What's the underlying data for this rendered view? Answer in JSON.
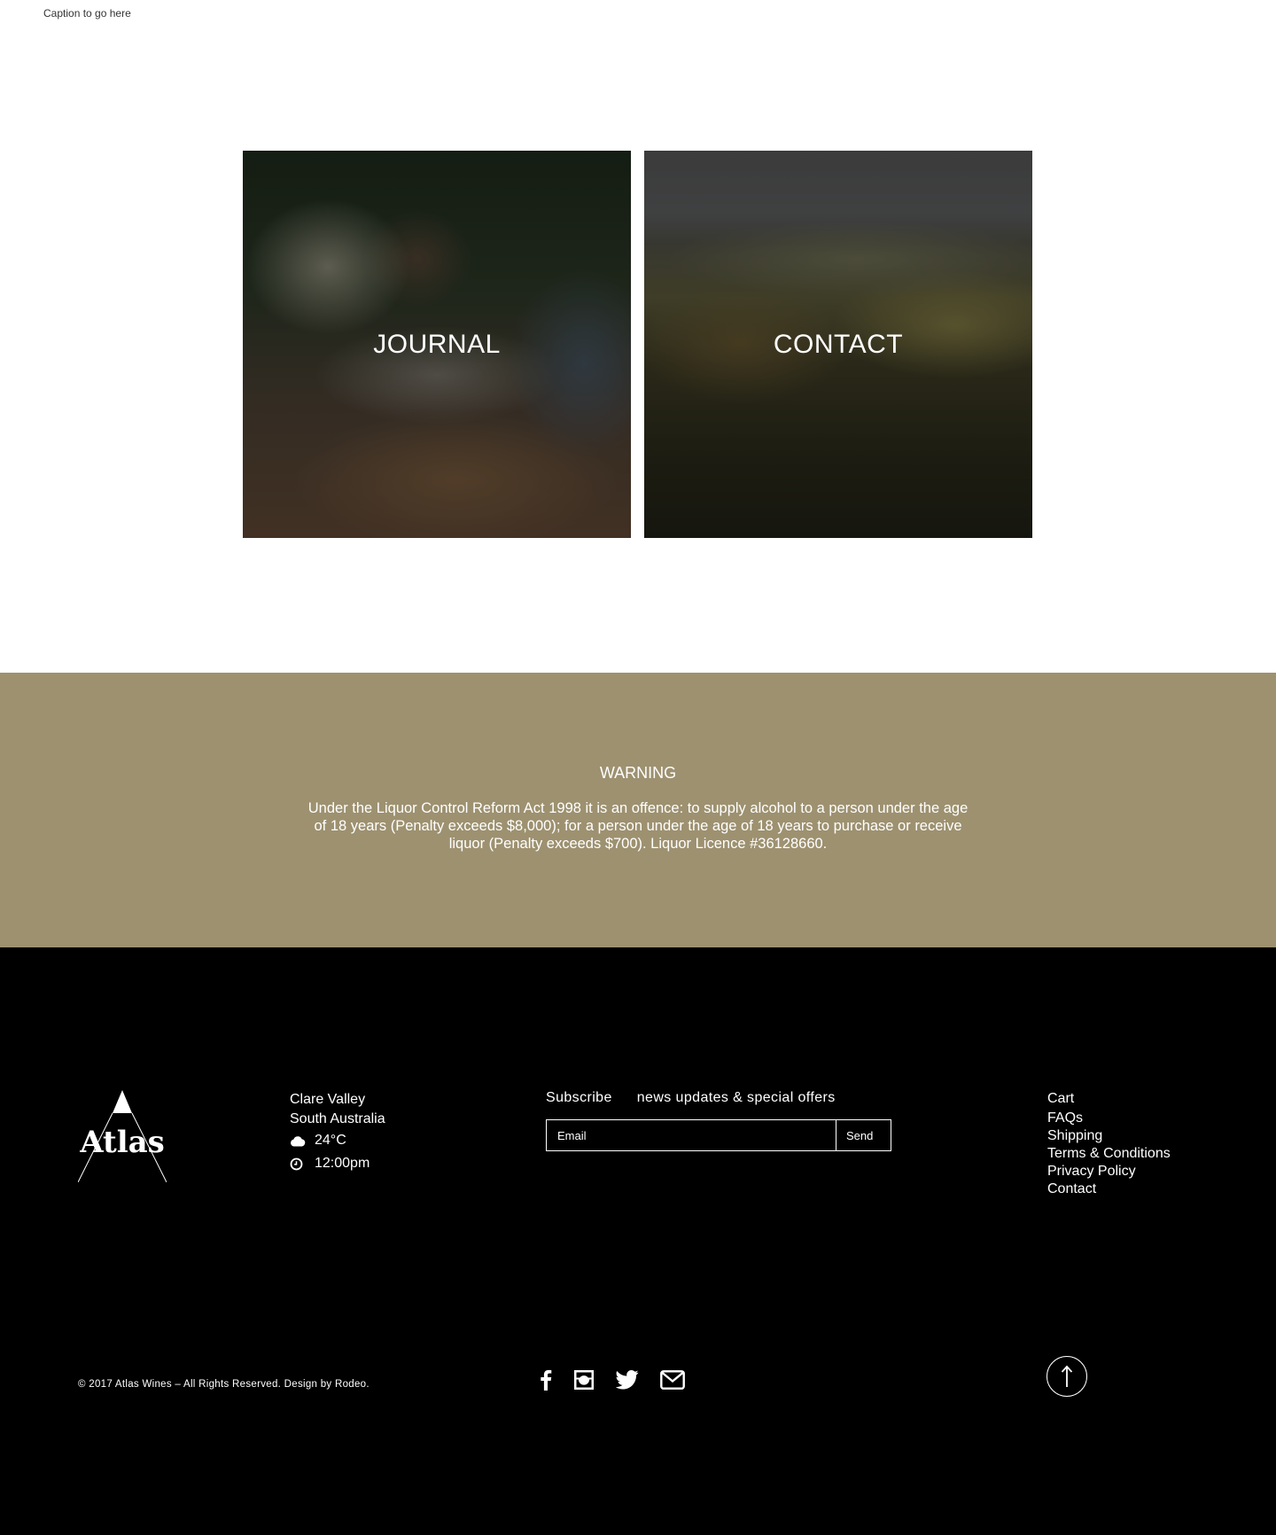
{
  "caption": "Caption to go here",
  "tiles": {
    "journal": {
      "label": "JOURNAL"
    },
    "contact": {
      "label": "CONTACT"
    }
  },
  "warning": {
    "title": "WARNING",
    "text": "Under the Liquor Control Reform Act 1998 it is an offence: to supply alcohol to a person under the age of 18 years (Penalty exceeds $8,000); for a person under the age of 18 years to purchase or receive liquor (Penalty exceeds $700). Liquor Licence #36128660."
  },
  "footer": {
    "logo_text": "Atlas",
    "location": {
      "line1": "Clare Valley",
      "line2": "South Australia",
      "temperature": "24°C",
      "time": "12:00pm",
      "weather_icon": "cloud-icon",
      "time_icon": "clock-icon"
    },
    "subscribe": {
      "heading": "Subscribe",
      "subheading": "news updates & special offers",
      "placeholder": "Email",
      "button": "Send"
    },
    "links": [
      "Cart",
      "FAQs",
      "Shipping",
      "Terms & Conditions",
      "Privacy Policy",
      "Contact"
    ],
    "copyright": "© 2017 Atlas Wines – All Rights Reserved. Design by Rodeo.",
    "socials": [
      "facebook-icon",
      "instagram-icon",
      "twitter-icon",
      "email-icon"
    ],
    "back_to_top_icon": "arrow-up-icon"
  },
  "colors": {
    "warning_bg": "#9d9170",
    "footer_bg": "#000000",
    "text_light": "#ffffff"
  }
}
